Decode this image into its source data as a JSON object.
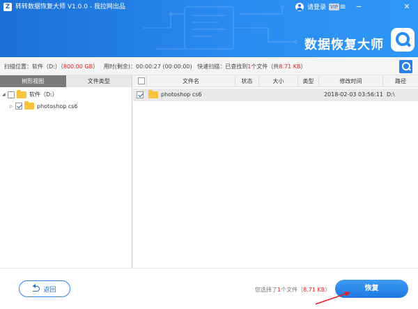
{
  "header": {
    "app_logo": "Z",
    "title": "转转数据恢复大师 V1.0.0 - 我拉网出品",
    "login_label": "请登录",
    "vip_badge": "VIP",
    "brand": "数据恢复大师",
    "window_controls": [
      "menu-icon",
      "minimize-icon",
      "close-icon"
    ]
  },
  "scan": {
    "location_label": "扫描位置：软件（",
    "drive": "D:",
    "size_open": "）（",
    "size": "800.00 GB",
    "size_close": "）",
    "time_label": "用时(剩余)：00:00:27 (00:00:00)",
    "mode_label": "快速扫描：已查找到",
    "found_count": "1",
    "found_unit": "个文件（共",
    "found_size": "8.71 KB",
    "found_close": "）"
  },
  "tabs": [
    "树形视图",
    "文件类型"
  ],
  "tree": [
    {
      "label": "软件（D:）",
      "checked": false
    },
    {
      "label": "photoshop cs6",
      "checked": true
    }
  ],
  "table": {
    "headers": [
      "文件名",
      "状态",
      "大小",
      "类型",
      "修改时间",
      "路径"
    ],
    "rows": [
      {
        "name": "photoshop cs6",
        "status": "",
        "size": "",
        "type": "",
        "modified": "2018-02-03 03:56:11",
        "path": "D:\\",
        "checked": true
      }
    ]
  },
  "footer": {
    "back_label": "返回",
    "selected_prefix": "您选择了",
    "selected_count": "1",
    "selected_mid": "个文件（",
    "selected_size": "8.71 KB",
    "selected_suffix": "）",
    "restore_label": "恢复"
  },
  "colors": {
    "header_blue": "#2a8bf0",
    "accent": "#2a82e4",
    "highlight_red": "#e02020"
  }
}
